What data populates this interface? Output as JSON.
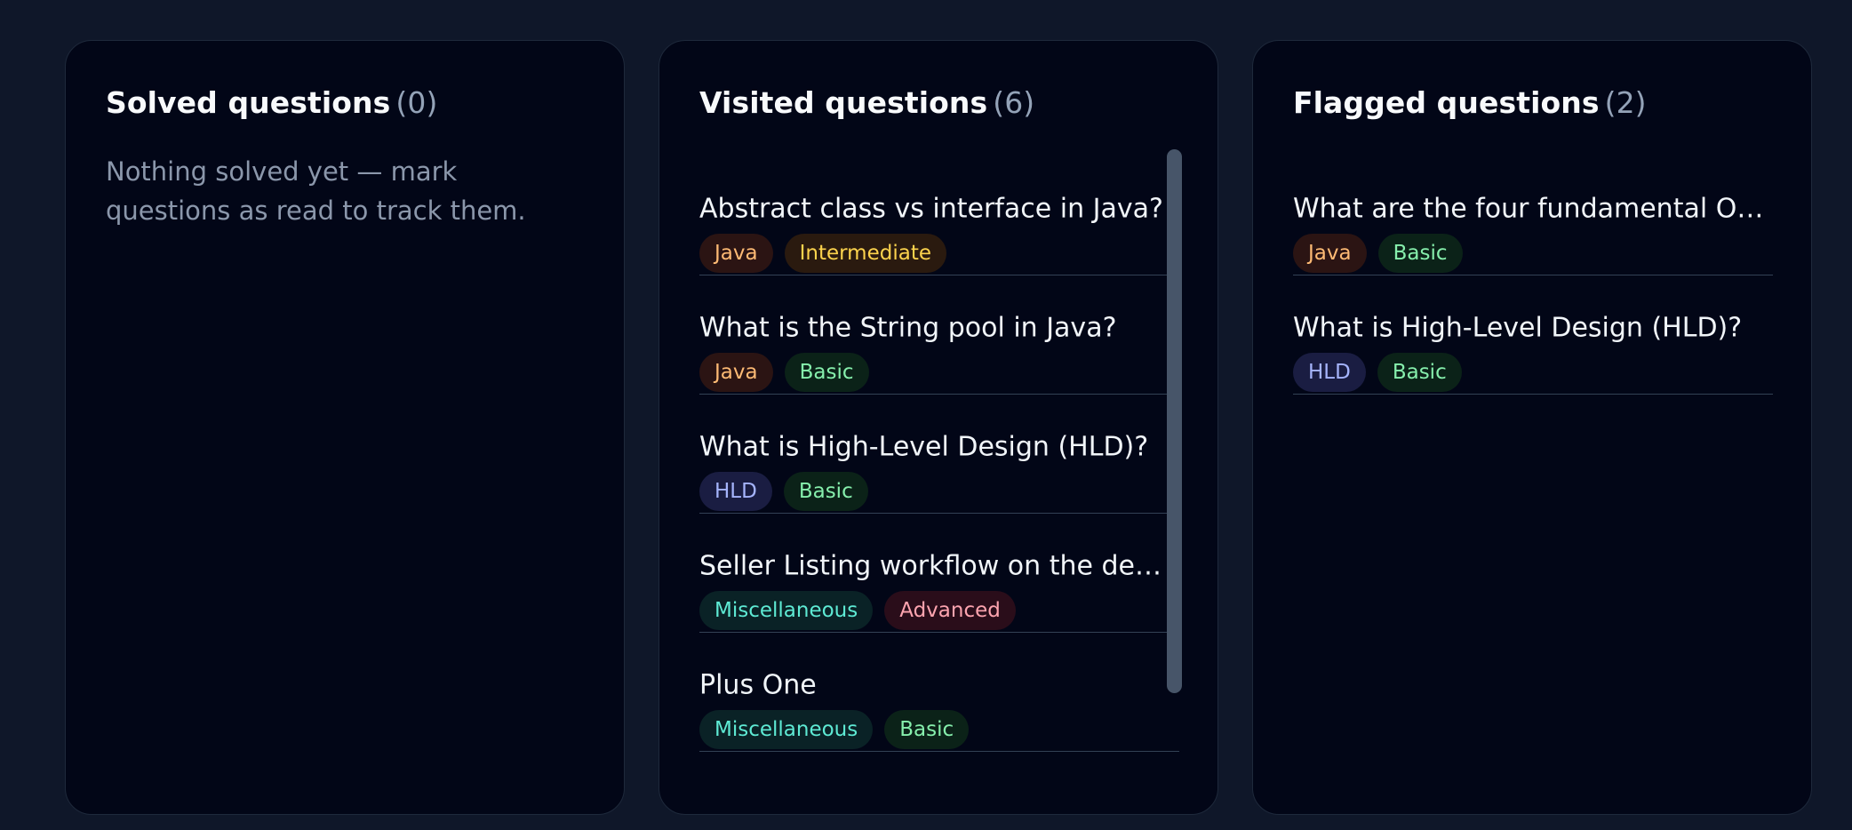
{
  "solved": {
    "title": "Solved questions",
    "count": "(0)",
    "empty_text": "Nothing solved yet — mark questions as read to track them."
  },
  "visited": {
    "title": "Visited questions",
    "count": "(6)",
    "items": [
      {
        "title": "Abstract class vs interface in Java?",
        "tags": [
          {
            "label": "Java",
            "kind": "java"
          },
          {
            "label": "Intermediate",
            "kind": "intermediate"
          }
        ]
      },
      {
        "title": "What is the String pool in Java?",
        "tags": [
          {
            "label": "Java",
            "kind": "java"
          },
          {
            "label": "Basic",
            "kind": "basic"
          }
        ]
      },
      {
        "title": "What is High-Level Design (HLD)?",
        "tags": [
          {
            "label": "HLD",
            "kind": "hld"
          },
          {
            "label": "Basic",
            "kind": "basic"
          }
        ]
      },
      {
        "title": "Seller Listing workflow on the des...",
        "tags": [
          {
            "label": "Miscellaneous",
            "kind": "misc"
          },
          {
            "label": "Advanced",
            "kind": "advanced"
          }
        ]
      },
      {
        "title": "Plus One",
        "tags": [
          {
            "label": "Miscellaneous",
            "kind": "misc"
          },
          {
            "label": "Basic",
            "kind": "basic"
          }
        ]
      }
    ]
  },
  "flagged": {
    "title": "Flagged questions",
    "count": "(2)",
    "items": [
      {
        "title": "What are the four fundamental OO...",
        "tags": [
          {
            "label": "Java",
            "kind": "java"
          },
          {
            "label": "Basic",
            "kind": "basic"
          }
        ]
      },
      {
        "title": "What is High-Level Design (HLD)?",
        "tags": [
          {
            "label": "HLD",
            "kind": "hld"
          },
          {
            "label": "Basic",
            "kind": "basic"
          }
        ]
      }
    ]
  },
  "colors": {
    "page_bg": "#0f1729",
    "panel_bg": "#020617",
    "tag_java": "#fdba74",
    "tag_intermediate": "#fcd34d",
    "tag_basic": "#86efac",
    "tag_hld": "#a5b4fc",
    "tag_misc": "#5eead4",
    "tag_advanced": "#fda4af"
  }
}
